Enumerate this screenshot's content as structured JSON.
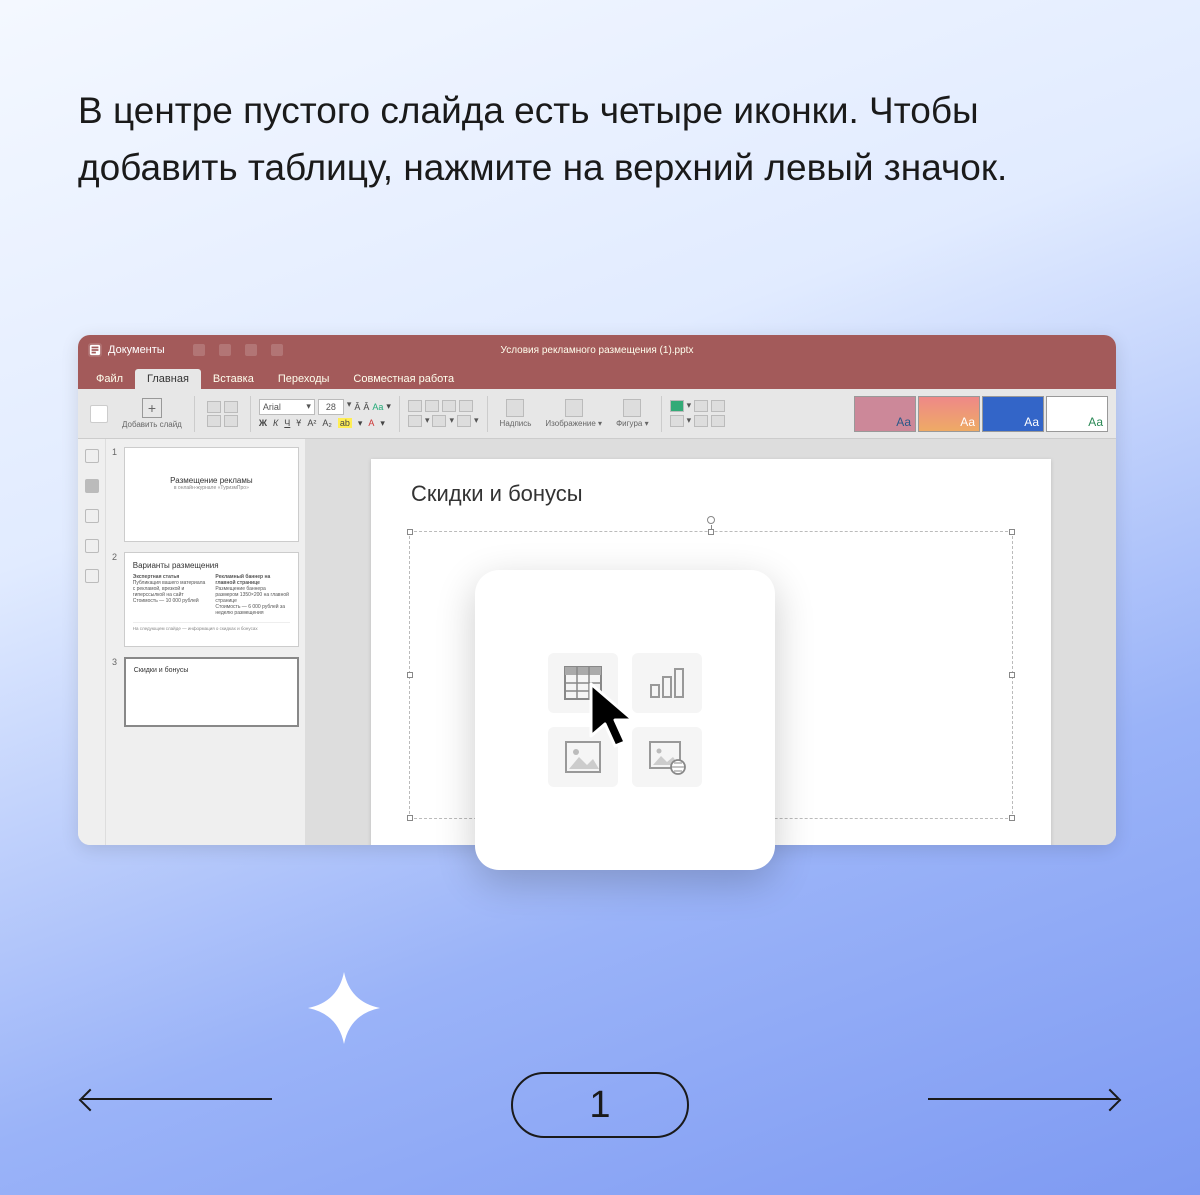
{
  "instruction": "В центре пустого слайда есть четыре иконки. Чтобы добавить таблицу, нажмите на верхний левый значок.",
  "titlebar": {
    "app_name": "Документы",
    "doc_title": "Условия рекламного размещения (1).pptx"
  },
  "menu": {
    "file": "Файл",
    "home": "Главная",
    "insert": "Вставка",
    "transitions": "Переходы",
    "collab": "Совместная работа"
  },
  "ribbon": {
    "add_slide": "Добавить слайд",
    "font_name": "Arial",
    "font_size": "28",
    "bold": "Ж",
    "italic": "К",
    "underline": "Ч",
    "strike": "Ұ",
    "textbox": "Надпись",
    "image": "Изображение",
    "shape": "Фигура",
    "theme_aa": "Аа"
  },
  "thumbs": [
    {
      "num": "1",
      "title": "Размещение рекламы",
      "sub": "в онлайн-журнале «ТуризмПро»"
    },
    {
      "num": "2",
      "title": "Варианты размещения",
      "col1_h": "Экспертная статья",
      "col1_t": "Публикация вашего материала с рекламой, врезкой и гиперссылкой на сайт",
      "col1_p": "Стоимость — 10 000 рублей",
      "col2_h": "Рекламный баннер на главной странице",
      "col2_t": "Размещение баннера размером 1350×200 на главной странице",
      "col2_p": "Стоимость — 6 000 рублей за неделю размещения",
      "footer": "На следующем слайде — информация о скидках и бонусах"
    },
    {
      "num": "3",
      "title": "Скидки и бонусы"
    }
  ],
  "canvas": {
    "slide_title": "Скидки и бонусы"
  },
  "popover_icons": [
    "table",
    "chart",
    "image",
    "online-image"
  ],
  "pager": {
    "current": "1"
  }
}
